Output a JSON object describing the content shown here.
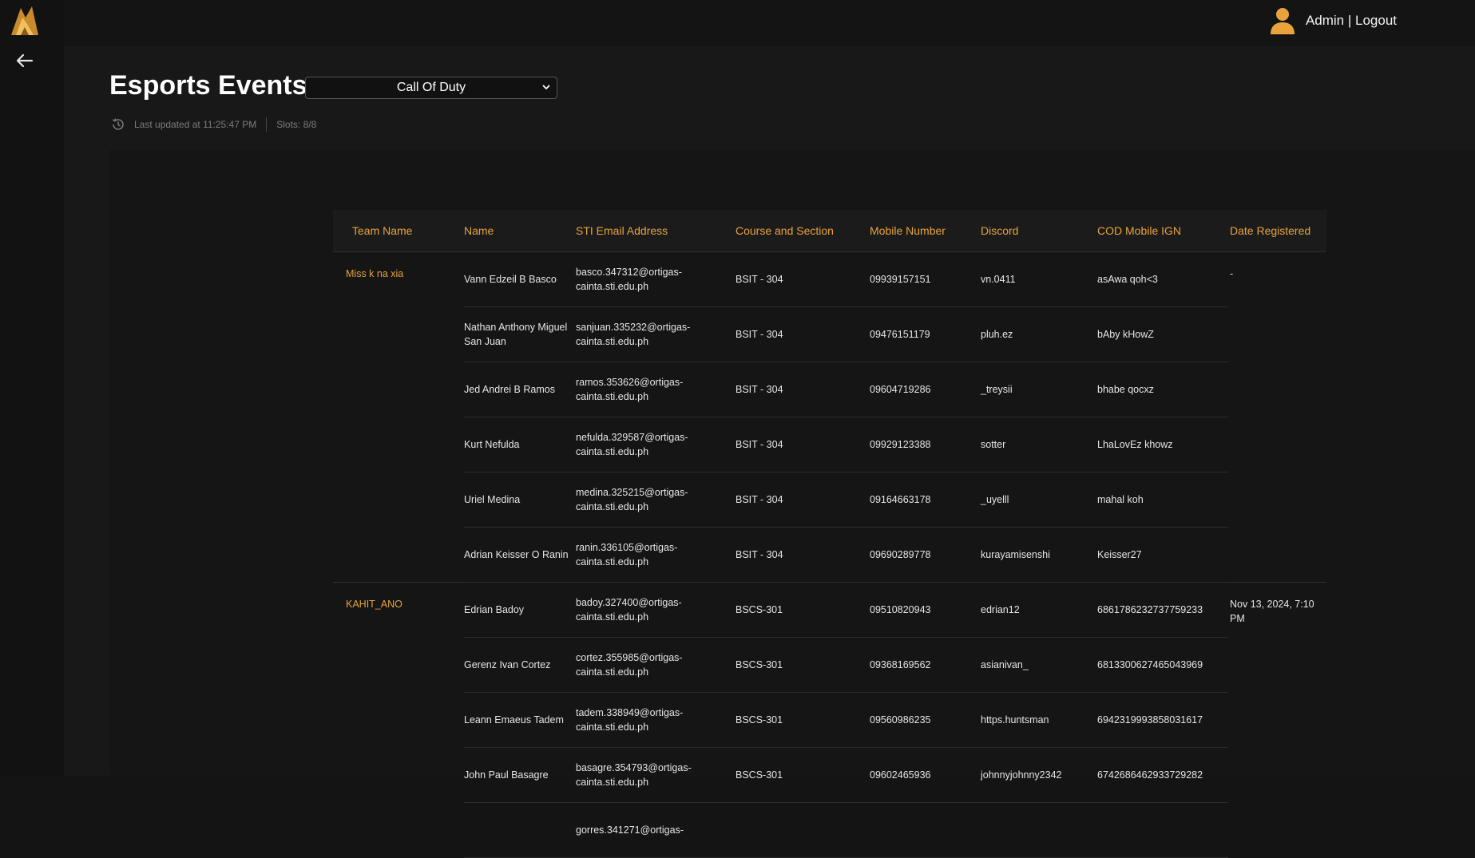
{
  "header": {
    "user_label": "Admin | Logout"
  },
  "page": {
    "title": "Esports Events",
    "selected_game": "Call Of Duty",
    "last_updated": "Last updated at 11:25:47 PM",
    "slots": "Slots: 8/8"
  },
  "table": {
    "columns": [
      "Team Name",
      "Name",
      "STI Email Address",
      "Course and Section",
      "Mobile Number",
      "Discord",
      "COD Mobile IGN",
      "Date Registered"
    ],
    "teams": [
      {
        "team": "Miss k na xia",
        "date": "-",
        "members": [
          {
            "name": "Vann Edzeil B Basco",
            "email": "basco.347312@ortigas-cainta.sti.edu.ph",
            "course": "BSIT - 304",
            "mobile": "09939157151",
            "discord": "vn.0411",
            "ign": "asAwa qoh<3"
          },
          {
            "name": "Nathan Anthony Miguel San Juan",
            "email": "sanjuan.335232@ortigas-cainta.sti.edu.ph",
            "course": "BSIT - 304",
            "mobile": "09476151179",
            "discord": "pluh.ez",
            "ign": "bAby kHowZ"
          },
          {
            "name": "Jed Andrei B Ramos",
            "email": "ramos.353626@ortigas-cainta.sti.edu.ph",
            "course": "BSIT - 304",
            "mobile": "09604719286",
            "discord": "_treysii",
            "ign": "bhabe qocxz"
          },
          {
            "name": "Kurt Nefulda",
            "email": "nefulda.329587@ortigas-cainta.sti.edu.ph",
            "course": "BSIT - 304",
            "mobile": "09929123388",
            "discord": "sotter",
            "ign": "LhaLovEz khowz"
          },
          {
            "name": "Uriel Medina",
            "email": "medina.325215@ortigas-cainta.sti.edu.ph",
            "course": "BSIT - 304",
            "mobile": "09164663178",
            "discord": "_uyelll",
            "ign": "mahal koh"
          },
          {
            "name": "Adrian Keisser O Ranin",
            "email": "ranin.336105@ortigas-cainta.sti.edu.ph",
            "course": "BSIT - 304",
            "mobile": "09690289778",
            "discord": "kurayamisenshi",
            "ign": "Keisser27"
          }
        ]
      },
      {
        "team": "KAHIT_ANO",
        "date": "Nov 13, 2024, 7:10 PM",
        "members": [
          {
            "name": "Edrian Badoy",
            "email": "badoy.327400@ortigas-cainta.sti.edu.ph",
            "course": "BSCS-301",
            "mobile": "09510820943",
            "discord": "edrian12",
            "ign": "6861786232737759233"
          },
          {
            "name": "Gerenz Ivan Cortez",
            "email": "cortez.355985@ortigas-cainta.sti.edu.ph",
            "course": "BSCS-301",
            "mobile": "09368169562",
            "discord": "asianivan_",
            "ign": "6813300627465043969"
          },
          {
            "name": "Leann Emaeus Tadem",
            "email": "tadem.338949@ortigas-cainta.sti.edu.ph",
            "course": "BSCS-301",
            "mobile": "09560986235",
            "discord": "https.huntsman",
            "ign": "6942319993858031617"
          },
          {
            "name": "John Paul Basagre",
            "email": "basagre.354793@ortigas-cainta.sti.edu.ph",
            "course": "BSCS-301",
            "mobile": "09602465936",
            "discord": "johnnyjohnny2342",
            "ign": "6742686462933729282"
          },
          {
            "name": "",
            "email": "gorres.341271@ortigas-",
            "course": "",
            "mobile": "",
            "discord": "",
            "ign": ""
          }
        ]
      }
    ]
  },
  "colors": {
    "accent": "#e8a33d",
    "background": "#141414"
  },
  "icons": {
    "logo": "fox-logo-icon",
    "back": "arrow-left-icon",
    "user": "user-avatar-icon",
    "history": "history-clock-icon",
    "dropdown": "chevron-down-icon"
  }
}
